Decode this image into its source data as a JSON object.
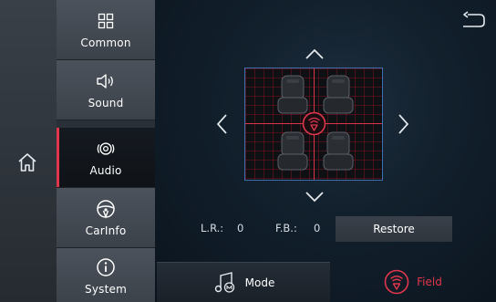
{
  "menu": {
    "items": [
      {
        "label": "Common",
        "icon": "grid-icon"
      },
      {
        "label": "Sound",
        "icon": "speaker-icon"
      },
      {
        "label": "Audio",
        "icon": "audio-icon",
        "active": true
      },
      {
        "label": "CarInfo",
        "icon": "steering-wheel-icon"
      },
      {
        "label": "System",
        "icon": "info-icon"
      }
    ]
  },
  "balance": {
    "lr_label": "L.R.:",
    "lr_value": "0",
    "fb_label": "F.B.:",
    "fb_value": "0",
    "restore_label": "Restore"
  },
  "tabs": {
    "mode_label": "Mode",
    "field_label": "Field"
  },
  "colors": {
    "accent": "#e0364b",
    "grid_border": "#3b6fb0"
  }
}
